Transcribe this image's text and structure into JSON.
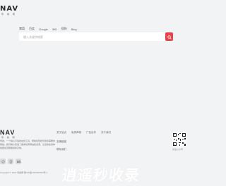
{
  "brand": {
    "name": "NAV",
    "subtitle": "导 航 网"
  },
  "search": {
    "tabs": [
      "常用",
      "百度",
      "Google",
      "360",
      "搜狗",
      "Bing"
    ],
    "active_tab": 0,
    "placeholder": "输入关键字搜索",
    "button_icon": "search-icon"
  },
  "footer": {
    "brand": {
      "name": "NAV",
      "subtitle": "导 航 网"
    },
    "description": "导航，一个精心打造的在线工具，帮助您轻松找到您需要的网站。我们精心筛选了各类优质网站和资源，让您的在线体验更加流畅便捷和高效。",
    "links_row": [
      "关于站点",
      "免责声明",
      "广告合作",
      "关于我们"
    ],
    "links_col": [
      "友情链接",
      "联系我们"
    ],
    "qr_label": "关注公众号",
    "copyright": "Copyright © 2024 导航网 豫ICP备2024000000号-1",
    "social_icons": [
      "wechat-icon",
      "qq-icon",
      "email-icon"
    ]
  },
  "watermark": "逍遥秒收录",
  "colors": {
    "accent": "#e8434a",
    "background": "#f2f3f5"
  }
}
